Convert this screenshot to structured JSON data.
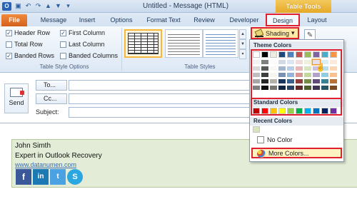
{
  "window": {
    "title": "Untitled - Message (HTML)",
    "contextual_tab_group": "Table Tools"
  },
  "tabs": [
    "File",
    "Message",
    "Insert",
    "Options",
    "Format Text",
    "Review",
    "Developer",
    "Design",
    "Layout"
  ],
  "table_style_options": {
    "header_row": "Header Row",
    "total_row": "Total Row",
    "banded_rows": "Banded Rows",
    "first_column": "First Column",
    "last_column": "Last Column",
    "banded_columns": "Banded Columns",
    "header_row_checked": true,
    "total_row_checked": false,
    "banded_rows_checked": true,
    "first_column_checked": true,
    "last_column_checked": false,
    "banded_columns_checked": false,
    "group_label": "Table Style Options"
  },
  "table_styles": {
    "group_label": "Table Styles"
  },
  "shading": {
    "label": "Shading"
  },
  "compose": {
    "send_label": "Send",
    "to_label": "To...",
    "cc_label": "Cc...",
    "subject_label": "Subject:"
  },
  "signature": {
    "name": "John Simth",
    "title": "Expert in Outlook Recovery",
    "url": "www.datanumen.com",
    "social_icons": [
      "facebook-icon",
      "linkedin-icon",
      "twitter-icon",
      "skype-icon"
    ]
  },
  "dropdown": {
    "theme_colors_label": "Theme Colors",
    "standard_colors_label": "Standard Colors",
    "recent_colors_label": "Recent Colors",
    "no_color_label": "No Color",
    "more_colors_label": "More Colors...",
    "theme_colors": [
      "#ffffff",
      "#000000",
      "#eeece1",
      "#1f497d",
      "#4f81bd",
      "#c0504d",
      "#9bbb59",
      "#8064a2",
      "#4bacc6",
      "#f79646"
    ],
    "standard_colors": [
      "#c00000",
      "#ff0000",
      "#ffc000",
      "#ffff00",
      "#92d050",
      "#00b050",
      "#00b0f0",
      "#0070c0",
      "#002060",
      "#7030a0"
    ],
    "recent_colors": [
      "#d7e4bc"
    ]
  },
  "colors": {
    "highlight_red": "#e0202f",
    "file_tab": "#e86f2a",
    "tools_gold": "#e5a928"
  }
}
